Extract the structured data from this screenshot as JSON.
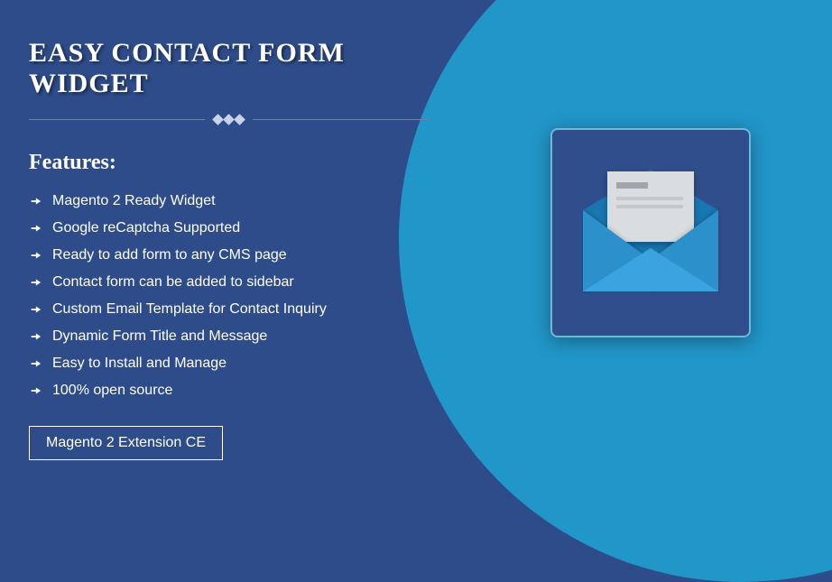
{
  "title": "EASY CONTACT FORM WIDGET",
  "features_heading": "Features:",
  "features": [
    "Magento 2 Ready Widget",
    "Google reCaptcha Supported",
    "Ready to add form to any CMS page",
    "Contact form can be added to sidebar",
    "Custom Email Template for Contact Inquiry",
    "Dynamic Form Title and Message",
    "Easy to Install and Manage",
    "100% open source"
  ],
  "badge": "Magento 2 Extension CE"
}
